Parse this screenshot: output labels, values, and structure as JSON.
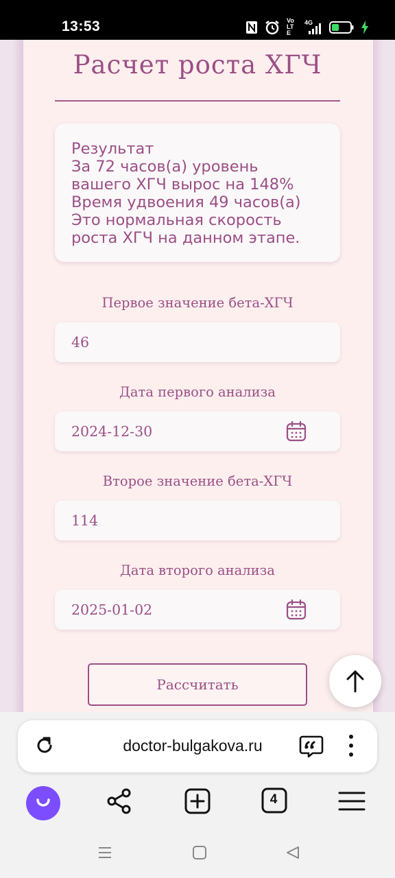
{
  "status_bar": {
    "time": "13:53",
    "icons": [
      "nfc-icon",
      "alarm-icon",
      "volte-icon",
      "signal-4g-icon",
      "battery-icon",
      "charging-icon"
    ],
    "volte_label": "Vo LTE",
    "network_label": "4G"
  },
  "page": {
    "title": "Расчет роста ХГЧ",
    "result": {
      "lines": [
        "Результат",
        "За 72 часов(а) уровень",
        "вашего ХГЧ вырос на 148%",
        "Время удвоения 49 часов(а)",
        "Это нормальная скорость",
        "роста ХГЧ на данном этапе."
      ]
    },
    "fields": [
      {
        "label": "Первое значение бета-ХГЧ",
        "value": "46",
        "type": "number"
      },
      {
        "label": "Дата первого анализа",
        "value": "2024-12-30",
        "type": "date"
      },
      {
        "label": "Второе значение бета-ХГЧ",
        "value": "114",
        "type": "number"
      },
      {
        "label": "Дата второго анализа",
        "value": "2025-01-02",
        "type": "date"
      }
    ],
    "calculate_label": "Рассчитать"
  },
  "browser": {
    "url": "doctor-bulgakova.ru",
    "tabs_count": "4"
  },
  "colors": {
    "accent": "#9b4f86",
    "card_bg": "#fcefee",
    "field_bg": "#faf8f9",
    "alice": "#7b4dff"
  }
}
